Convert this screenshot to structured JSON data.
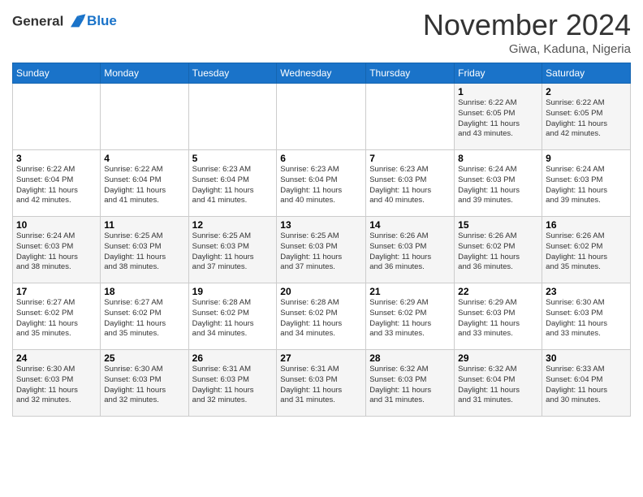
{
  "header": {
    "logo_line1": "General",
    "logo_line2": "Blue",
    "month": "November 2024",
    "location": "Giwa, Kaduna, Nigeria"
  },
  "weekdays": [
    "Sunday",
    "Monday",
    "Tuesday",
    "Wednesday",
    "Thursday",
    "Friday",
    "Saturday"
  ],
  "weeks": [
    [
      {
        "day": "",
        "info": ""
      },
      {
        "day": "",
        "info": ""
      },
      {
        "day": "",
        "info": ""
      },
      {
        "day": "",
        "info": ""
      },
      {
        "day": "",
        "info": ""
      },
      {
        "day": "1",
        "info": "Sunrise: 6:22 AM\nSunset: 6:05 PM\nDaylight: 11 hours\nand 43 minutes."
      },
      {
        "day": "2",
        "info": "Sunrise: 6:22 AM\nSunset: 6:05 PM\nDaylight: 11 hours\nand 42 minutes."
      }
    ],
    [
      {
        "day": "3",
        "info": "Sunrise: 6:22 AM\nSunset: 6:04 PM\nDaylight: 11 hours\nand 42 minutes."
      },
      {
        "day": "4",
        "info": "Sunrise: 6:22 AM\nSunset: 6:04 PM\nDaylight: 11 hours\nand 41 minutes."
      },
      {
        "day": "5",
        "info": "Sunrise: 6:23 AM\nSunset: 6:04 PM\nDaylight: 11 hours\nand 41 minutes."
      },
      {
        "day": "6",
        "info": "Sunrise: 6:23 AM\nSunset: 6:04 PM\nDaylight: 11 hours\nand 40 minutes."
      },
      {
        "day": "7",
        "info": "Sunrise: 6:23 AM\nSunset: 6:03 PM\nDaylight: 11 hours\nand 40 minutes."
      },
      {
        "day": "8",
        "info": "Sunrise: 6:24 AM\nSunset: 6:03 PM\nDaylight: 11 hours\nand 39 minutes."
      },
      {
        "day": "9",
        "info": "Sunrise: 6:24 AM\nSunset: 6:03 PM\nDaylight: 11 hours\nand 39 minutes."
      }
    ],
    [
      {
        "day": "10",
        "info": "Sunrise: 6:24 AM\nSunset: 6:03 PM\nDaylight: 11 hours\nand 38 minutes."
      },
      {
        "day": "11",
        "info": "Sunrise: 6:25 AM\nSunset: 6:03 PM\nDaylight: 11 hours\nand 38 minutes."
      },
      {
        "day": "12",
        "info": "Sunrise: 6:25 AM\nSunset: 6:03 PM\nDaylight: 11 hours\nand 37 minutes."
      },
      {
        "day": "13",
        "info": "Sunrise: 6:25 AM\nSunset: 6:03 PM\nDaylight: 11 hours\nand 37 minutes."
      },
      {
        "day": "14",
        "info": "Sunrise: 6:26 AM\nSunset: 6:03 PM\nDaylight: 11 hours\nand 36 minutes."
      },
      {
        "day": "15",
        "info": "Sunrise: 6:26 AM\nSunset: 6:02 PM\nDaylight: 11 hours\nand 36 minutes."
      },
      {
        "day": "16",
        "info": "Sunrise: 6:26 AM\nSunset: 6:02 PM\nDaylight: 11 hours\nand 35 minutes."
      }
    ],
    [
      {
        "day": "17",
        "info": "Sunrise: 6:27 AM\nSunset: 6:02 PM\nDaylight: 11 hours\nand 35 minutes."
      },
      {
        "day": "18",
        "info": "Sunrise: 6:27 AM\nSunset: 6:02 PM\nDaylight: 11 hours\nand 35 minutes."
      },
      {
        "day": "19",
        "info": "Sunrise: 6:28 AM\nSunset: 6:02 PM\nDaylight: 11 hours\nand 34 minutes."
      },
      {
        "day": "20",
        "info": "Sunrise: 6:28 AM\nSunset: 6:02 PM\nDaylight: 11 hours\nand 34 minutes."
      },
      {
        "day": "21",
        "info": "Sunrise: 6:29 AM\nSunset: 6:02 PM\nDaylight: 11 hours\nand 33 minutes."
      },
      {
        "day": "22",
        "info": "Sunrise: 6:29 AM\nSunset: 6:03 PM\nDaylight: 11 hours\nand 33 minutes."
      },
      {
        "day": "23",
        "info": "Sunrise: 6:30 AM\nSunset: 6:03 PM\nDaylight: 11 hours\nand 33 minutes."
      }
    ],
    [
      {
        "day": "24",
        "info": "Sunrise: 6:30 AM\nSunset: 6:03 PM\nDaylight: 11 hours\nand 32 minutes."
      },
      {
        "day": "25",
        "info": "Sunrise: 6:30 AM\nSunset: 6:03 PM\nDaylight: 11 hours\nand 32 minutes."
      },
      {
        "day": "26",
        "info": "Sunrise: 6:31 AM\nSunset: 6:03 PM\nDaylight: 11 hours\nand 32 minutes."
      },
      {
        "day": "27",
        "info": "Sunrise: 6:31 AM\nSunset: 6:03 PM\nDaylight: 11 hours\nand 31 minutes."
      },
      {
        "day": "28",
        "info": "Sunrise: 6:32 AM\nSunset: 6:03 PM\nDaylight: 11 hours\nand 31 minutes."
      },
      {
        "day": "29",
        "info": "Sunrise: 6:32 AM\nSunset: 6:04 PM\nDaylight: 11 hours\nand 31 minutes."
      },
      {
        "day": "30",
        "info": "Sunrise: 6:33 AM\nSunset: 6:04 PM\nDaylight: 11 hours\nand 30 minutes."
      }
    ]
  ]
}
